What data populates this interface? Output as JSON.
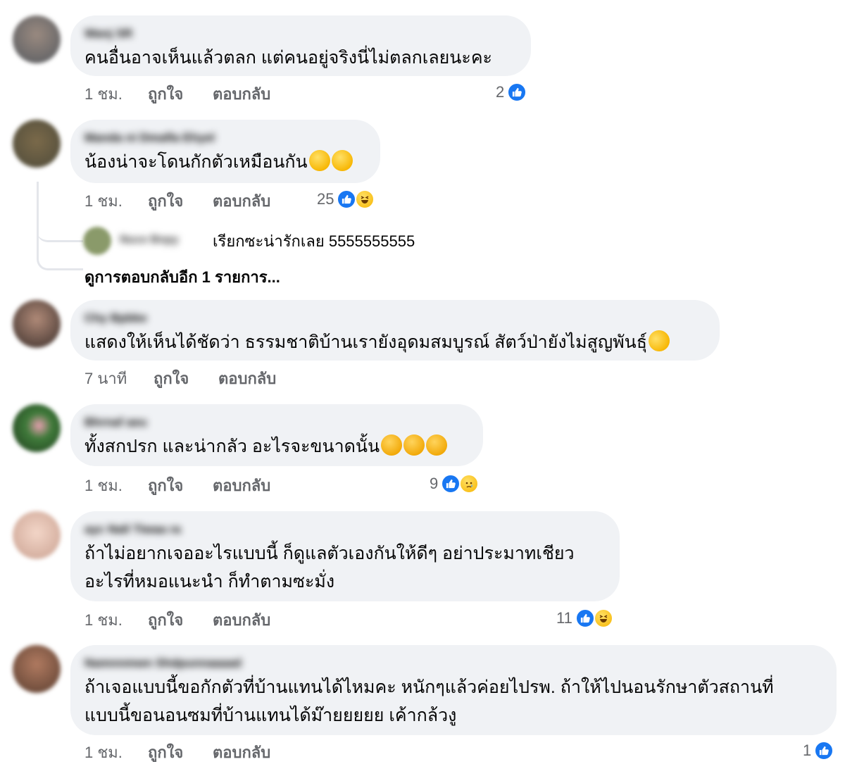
{
  "colors": {
    "bubble_bg": "#f0f2f5",
    "like_blue": "#1877f2",
    "meta_text": "#65676b"
  },
  "comments": [
    {
      "author": "Wanj SR",
      "text_lines": [
        "คนอื่นอาจเห็นแล้วตลก แต่คนอยู่จริงนี่ไม่ตลกเลยนะคะ"
      ],
      "emojis": [],
      "time": "1 ชม.",
      "like_label": "ถูกใจ",
      "reply_label": "ตอบกลับ",
      "reaction_count": "2",
      "reaction_icons": [
        "like-icon"
      ]
    },
    {
      "author": "Manda ni Dmafla Ehyel",
      "text_lines": [
        "น้องน่าจะโดนกักตัวเหมือนกัน"
      ],
      "emojis": [
        "tears-of-joy-icon",
        "tears-of-joy-icon"
      ],
      "time": "1 ชม.",
      "like_label": "ถูกใจ",
      "reply_label": "ตอบกลับ",
      "reaction_count": "25",
      "reaction_icons": [
        "like-icon",
        "haha-icon"
      ],
      "reply": {
        "author": "Nuce Bnpy",
        "text": "เรียกซะน่ารักเลย 5555555555"
      },
      "more_replies": "ดูการตอบกลับอีก 1 รายการ..."
    },
    {
      "author": "Chy Bpbke",
      "text_lines": [
        "แสดงให้เห็นได้ชัดว่า ธรรมชาติบ้านเรายังอุดมสมบูรณ์ สัตว์ป่ายังไม่สูญพันธุ์"
      ],
      "emojis": [
        "rofl-icon"
      ],
      "time": "7 นาที",
      "like_label": "ถูกใจ",
      "reply_label": "ตอบกลับ",
      "reaction_count": "",
      "reaction_icons": []
    },
    {
      "author": "Bhrnaf aeu",
      "text_lines": [
        "ทั้งสกปรก และน่ากลัว อะไรจะขนาดนั้น"
      ],
      "emojis": [
        "pleading-face-icon",
        "pleading-face-icon",
        "pleading-face-icon"
      ],
      "time": "1 ชม.",
      "like_label": "ถูกใจ",
      "reply_label": "ตอบกลับ",
      "reaction_count": "9",
      "reaction_icons": [
        "like-icon",
        "sad-icon"
      ]
    },
    {
      "author": "ayc Nall Tiwaa ra",
      "text_lines": [
        "ถ้าไม่อยากเจออะไรแบบนี้ ก็ดูแลตัวเองกันให้ดีๆ อย่าประมาทเชียว",
        "อะไรที่หมอแนะนำ ก็ทำตามซะมั่ง"
      ],
      "emojis": [],
      "time": "1 ชม.",
      "like_label": "ถูกใจ",
      "reply_label": "ตอบกลับ",
      "reaction_count": "11",
      "reaction_icons": [
        "like-icon",
        "haha-icon"
      ]
    },
    {
      "author": "Namnnmwn Shdpunnaaaad",
      "text_lines": [
        "ถ้าเจอแบบนี้ขอกักตัวที่บ้านแทนได้ไหมคะ หนักๆแล้วค่อยไปรพ. ถ้าให้ไปนอนรักษาตัวสถานที่",
        "แบบนี้ขอนอนซมที่บ้านแทนได้ม๊ายยยยย เค้ากล้วงู"
      ],
      "emojis": [],
      "time": "1 ชม.",
      "like_label": "ถูกใจ",
      "reply_label": "ตอบกลับ",
      "reaction_count": "1",
      "reaction_icons": [
        "like-icon"
      ]
    }
  ]
}
